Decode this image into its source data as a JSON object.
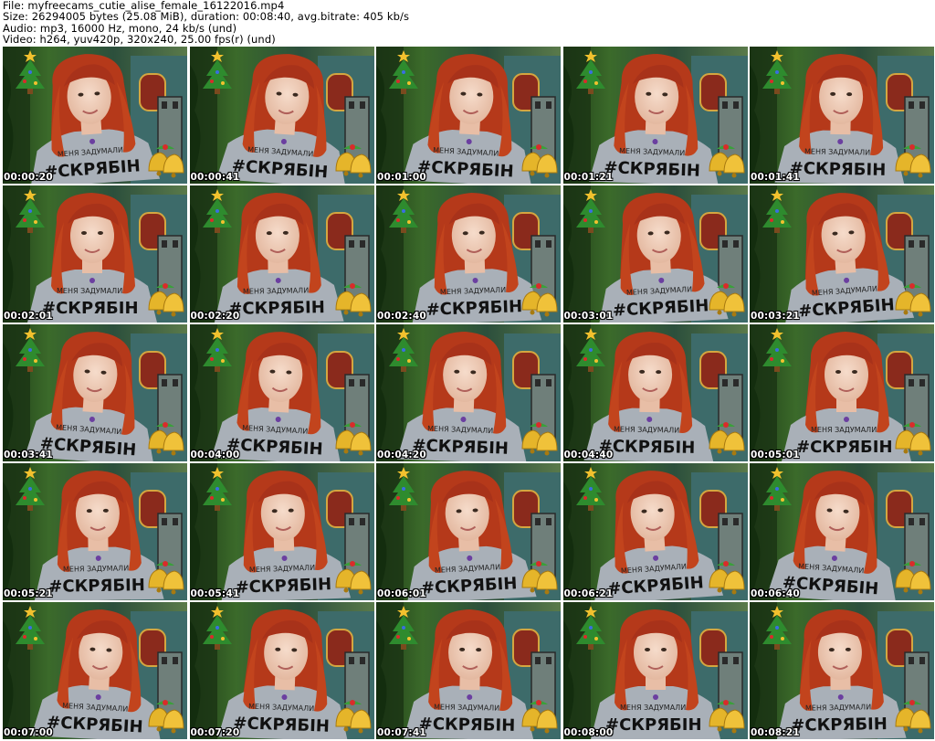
{
  "header": {
    "file_line": "File: myfreecams_cutie_alise_female_16122016.mp4",
    "size_line": "Size: 26294005 bytes (25.08 MiB), duration: 00:08:40, avg.bitrate: 405 kb/s",
    "audio_line": "Audio: mp3, 16000 Hz, mono, 24 kb/s (und)",
    "video_line": "Video: h264, yuv420p, 320x240, 25.00 fps(r) (und)"
  },
  "thumbnails": [
    {
      "timestamp": "00:00:20"
    },
    {
      "timestamp": "00:00:41"
    },
    {
      "timestamp": "00:01:00"
    },
    {
      "timestamp": "00:01:21"
    },
    {
      "timestamp": "00:01:41"
    },
    {
      "timestamp": "00:02:01"
    },
    {
      "timestamp": "00:02:20"
    },
    {
      "timestamp": "00:02:40"
    },
    {
      "timestamp": "00:03:01"
    },
    {
      "timestamp": "00:03:21"
    },
    {
      "timestamp": "00:03:41"
    },
    {
      "timestamp": "00:04:00"
    },
    {
      "timestamp": "00:04:20"
    },
    {
      "timestamp": "00:04:40"
    },
    {
      "timestamp": "00:05:01"
    },
    {
      "timestamp": "00:05:21"
    },
    {
      "timestamp": "00:05:41"
    },
    {
      "timestamp": "00:06:01"
    },
    {
      "timestamp": "00:06:21"
    },
    {
      "timestamp": "00:06:40"
    },
    {
      "timestamp": "00:07:00"
    },
    {
      "timestamp": "00:07:20"
    },
    {
      "timestamp": "00:07:41"
    },
    {
      "timestamp": "00:08:00"
    },
    {
      "timestamp": "00:08:21"
    }
  ],
  "shirt_text": "#СКРЯБІН",
  "colors": {
    "hair": "#b5391a",
    "shirt": "#a9b0b8",
    "background_green": "#2f5a1e",
    "wall_teal": "#3d6b6a",
    "door_red": "#8a2a1c"
  },
  "icons": [
    "christmas-tree-icon",
    "bells-icon"
  ]
}
